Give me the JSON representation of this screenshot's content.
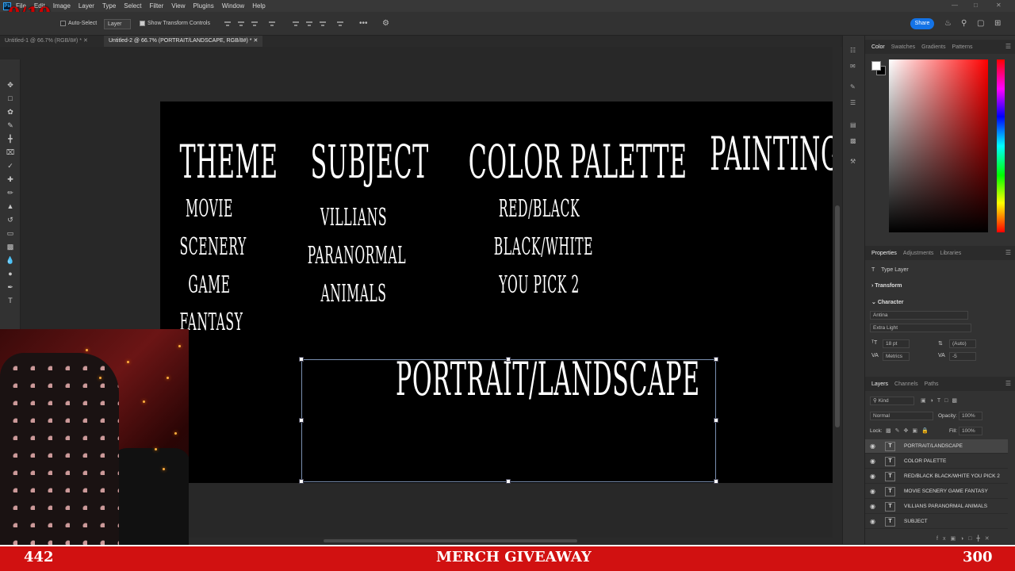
{
  "app": {
    "menu": [
      "File",
      "Edit",
      "Image",
      "Layer",
      "Type",
      "Select",
      "Filter",
      "View",
      "Plugins",
      "Window",
      "Help"
    ],
    "overlay_counter": "0/10"
  },
  "options": {
    "auto_select": "Auto-Select",
    "layer_select": "Layer",
    "show_transform": "Show Transform Controls",
    "share": "Share"
  },
  "tabs": [
    {
      "label": "Untitled-1 @ 66.7% (RGB/8#) *",
      "active": false
    },
    {
      "label": "Untitled-2 @ 66.7% (PORTRAIT/LANDSCAPE, RGB/8#) *",
      "active": true
    }
  ],
  "canvas": {
    "theme": {
      "heading": "THEME",
      "items": [
        "MOVIE",
        "SCENERY",
        "GAME",
        "FANTASY"
      ]
    },
    "subject": {
      "heading": "SUBJECT",
      "items": [
        "VILLIANS",
        "PARANORMAL",
        "ANIMALS"
      ]
    },
    "palette": {
      "heading": "COLOR PALETTE",
      "items": [
        "RED/BLACK",
        "BLACK/WHITE",
        "YOU PICK 2"
      ]
    },
    "painting": "PAINTING",
    "portrait": "PORTRAIT/LANDSCAPE"
  },
  "color_panel": {
    "tabs": [
      "Color",
      "Swatches",
      "Gradients",
      "Patterns"
    ]
  },
  "properties": {
    "tabs": [
      "Properties",
      "Adjustments",
      "Libraries"
    ],
    "layer_type": "Type Layer",
    "transform": "Transform",
    "character": "Character",
    "font_family": "Antina",
    "font_style": "Extra Light",
    "font_size": "18 pt",
    "leading": "(Auto)",
    "kerning": "Metrics",
    "tracking": "-5"
  },
  "layers_panel": {
    "tabs": [
      "Layers",
      "Channels",
      "Paths"
    ],
    "kind": "Kind",
    "blend": "Normal",
    "opacity_label": "Opacity:",
    "opacity": "100%",
    "lock_label": "Lock:",
    "fill_label": "Fill:",
    "fill": "100%",
    "layers": [
      {
        "name": "PORTRAIT/LANDSCAPE",
        "selected": true
      },
      {
        "name": "COLOR PALETTE",
        "selected": false
      },
      {
        "name": "RED/BLACK BLACK/WHITE YOU PICK 2",
        "selected": false
      },
      {
        "name": "MOVIE SCENERY GAME FANTASY",
        "selected": false
      },
      {
        "name": "VILLIANS PARANORMAL ANIMALS",
        "selected": false
      },
      {
        "name": "SUBJECT",
        "selected": false
      }
    ]
  },
  "banner": {
    "left": "442",
    "title": "MERCH GIVEAWAY",
    "right": "300"
  },
  "colors": {
    "banner": "#d11111",
    "accent": "#1473e6"
  }
}
